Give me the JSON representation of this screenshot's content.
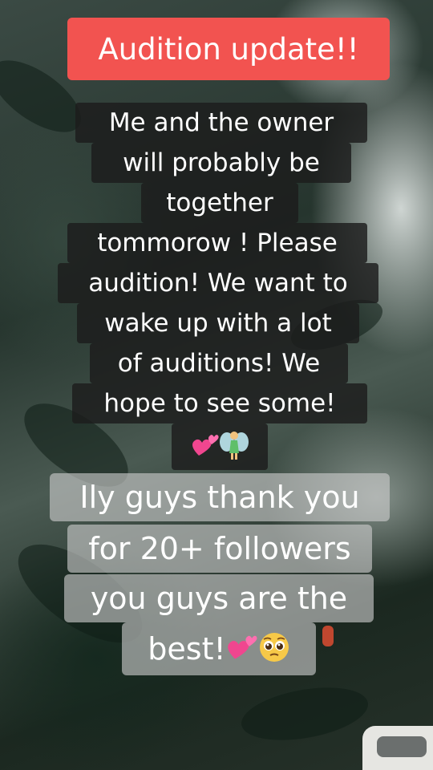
{
  "title": "Audition update!!",
  "message_lines": [
    "Me and the owner",
    "will probably be",
    "together",
    "tommorow ! Please",
    "audition! We want to",
    "wake up with a lot",
    "of auditions! We",
    "hope to see some!"
  ],
  "thanks_lines": [
    "Ily guys thank you",
    "for 20+ followers",
    "you guys are the",
    "best!"
  ],
  "emoji_names": {
    "message_end": [
      "two-hearts",
      "fairy"
    ],
    "thanks_end": [
      "two-hearts",
      "pleading-face"
    ]
  },
  "colors": {
    "title_bg": "#f25350",
    "dark_caption_bg": "rgba(28,28,28,0.82)",
    "light_caption_bg": "rgba(205,205,205,0.62)",
    "text": "#ffffff"
  }
}
